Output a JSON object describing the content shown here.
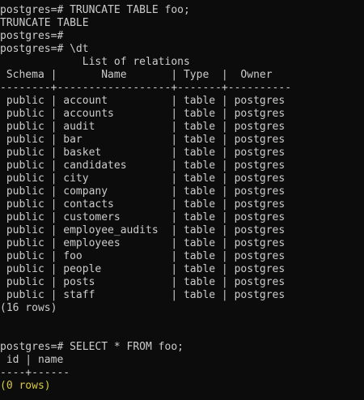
{
  "colors": {
    "background": "#0c0c0c",
    "text": "#cccccc",
    "row_count_highlight": "#d7c845"
  },
  "session": {
    "lines": [
      "postgres=# TRUNCATE TABLE foo;",
      "TRUNCATE TABLE",
      "postgres=#",
      "postgres=# \\dt",
      "             List of relations",
      " Schema |       Name       | Type  |  Owner",
      "--------+------------------+-------+----------",
      " public | account          | table | postgres",
      " public | accounts         | table | postgres",
      " public | audit            | table | postgres",
      " public | bar              | table | postgres",
      " public | basket           | table | postgres",
      " public | candidates       | table | postgres",
      " public | city             | table | postgres",
      " public | company          | table | postgres",
      " public | contacts         | table | postgres",
      " public | customers        | table | postgres",
      " public | employee_audits  | table | postgres",
      " public | employees        | table | postgres",
      " public | foo              | table | postgres",
      " public | people           | table | postgres",
      " public | posts            | table | postgres",
      " public | staff            | table | postgres",
      "(16 rows)",
      "",
      "",
      "postgres=# SELECT * FROM foo;",
      " id | name",
      "----+------",
      "(0 rows)"
    ]
  }
}
